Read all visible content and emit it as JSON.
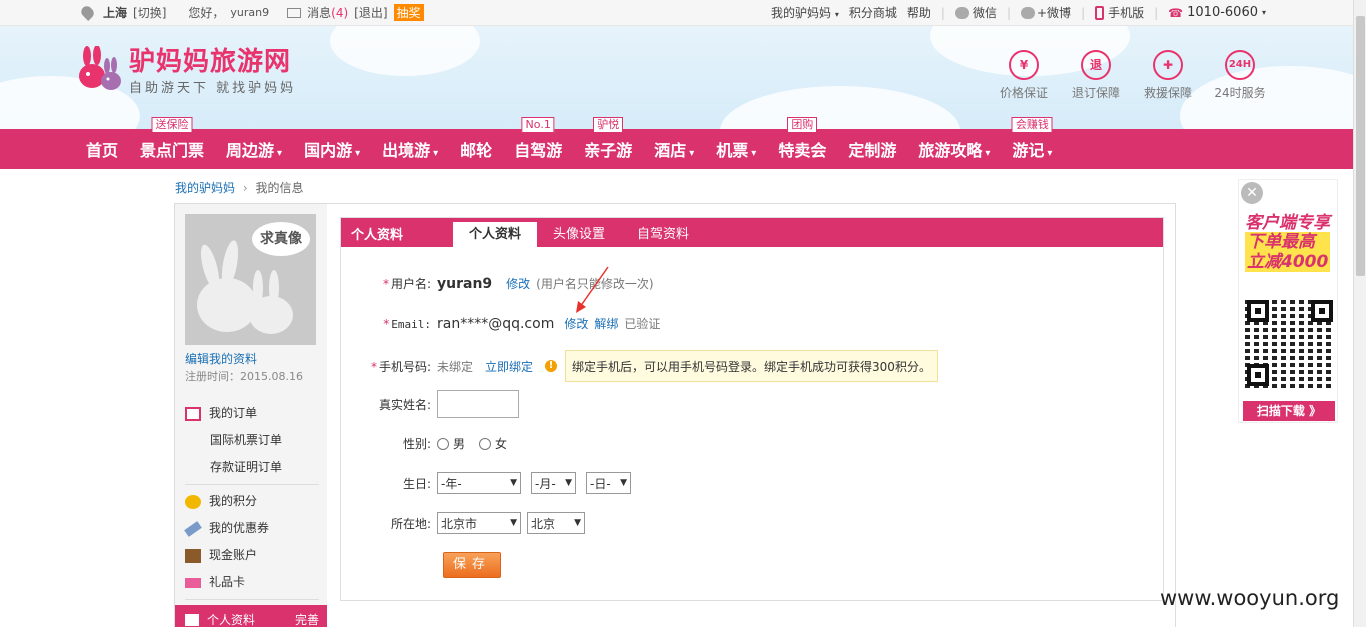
{
  "topbar": {
    "city": "上海",
    "switch": "[切换]",
    "greeting": "您好，",
    "username": "yuran9",
    "messages_label": "消息",
    "messages_count": "(4)",
    "logout": "[退出]",
    "lottery": "抽奖",
    "my_lvmama": "我的驴妈妈",
    "points_mall": "积分商城",
    "help": "帮助",
    "wechat": "微信",
    "weibo": "+微博",
    "mobile": "手机版",
    "hotline": "1010-6060"
  },
  "header": {
    "logo_title": "驴妈妈旅游网",
    "logo_sub": "自助游天下 就找驴妈妈",
    "guarantees": [
      {
        "glyph": "¥",
        "label": "价格保证"
      },
      {
        "glyph": "退",
        "label": "退订保障"
      },
      {
        "glyph": "✚",
        "label": "救援保障"
      },
      {
        "glyph": "24H",
        "label": "24时服务"
      }
    ]
  },
  "nav": {
    "items": [
      {
        "label": "首页",
        "caret": "",
        "tag": ""
      },
      {
        "label": "景点门票",
        "caret": "",
        "tag": "送保险"
      },
      {
        "label": "周边游",
        "caret": "▾",
        "tag": ""
      },
      {
        "label": "国内游",
        "caret": "▾",
        "tag": ""
      },
      {
        "label": "出境游",
        "caret": "▾",
        "tag": ""
      },
      {
        "label": "邮轮",
        "caret": "",
        "tag": ""
      },
      {
        "label": "自驾游",
        "caret": "",
        "tag": "No.1"
      },
      {
        "label": "亲子游",
        "caret": "",
        "tag": "驴悦"
      },
      {
        "label": "酒店",
        "caret": "▾",
        "tag": ""
      },
      {
        "label": "机票",
        "caret": "▾",
        "tag": ""
      },
      {
        "label": "特卖会",
        "caret": "",
        "tag": "团购"
      },
      {
        "label": "定制游",
        "caret": "",
        "tag": ""
      },
      {
        "label": "旅游攻略",
        "caret": "▾",
        "tag": ""
      },
      {
        "label": "游记",
        "caret": "▾",
        "tag": "会赚钱"
      }
    ]
  },
  "breadcrumb": {
    "home": "我的驴妈妈",
    "sep": "›",
    "current": "我的信息"
  },
  "sidebar": {
    "avatar_bubble": "求真像",
    "edit_profile": "编辑我的资料",
    "reg_time": "注册时间：2015.08.16",
    "menu": {
      "orders": "我的订单",
      "intl_flight_orders": "国际机票订单",
      "deposit_orders": "存款证明订单",
      "points": "我的积分",
      "coupons": "我的优惠券",
      "cash_account": "现金账户",
      "gift_card": "礼品卡",
      "profile": "个人资料",
      "profile_status": "完善"
    }
  },
  "panel": {
    "title": "个人资料",
    "tabs": [
      "个人资料",
      "头像设置",
      "自驾资料"
    ],
    "username": {
      "label": "用户名:",
      "value": "yuran9",
      "edit": "修改",
      "note": "(用户名只能修改一次)"
    },
    "email": {
      "label": "Email:",
      "value": "ran****@qq.com",
      "edit": "修改",
      "unbind": "解绑",
      "status": "已验证"
    },
    "phone": {
      "label": "手机号码:",
      "status": "未绑定",
      "bind": "立即绑定",
      "tip": "绑定手机后，可以用手机号码登录。绑定手机成功可获得300积分。"
    },
    "realname": {
      "label": "真实姓名:"
    },
    "gender": {
      "label": "性别:",
      "male": "男",
      "female": "女"
    },
    "birthday": {
      "label": "生日:",
      "year": "-年-",
      "month": "-月-",
      "day": "-日-"
    },
    "location": {
      "label": "所在地:",
      "province": "北京市",
      "city": "北京"
    },
    "save": "保存"
  },
  "promo": {
    "close": "✕",
    "line1": "客户端专享",
    "line2": "下单最高",
    "line3": "立减4000",
    "download": "扫描下载 》"
  },
  "watermark": "www.wooyun.org",
  "colors": {
    "brand": "#d9326d",
    "link": "#1a6fb5",
    "button": "#ec6e1d"
  }
}
